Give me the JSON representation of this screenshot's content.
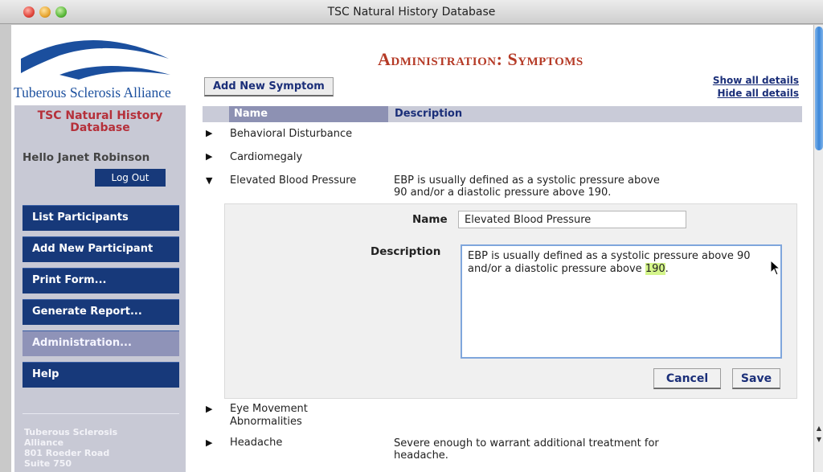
{
  "window": {
    "title": "TSC Natural History Database"
  },
  "sidebar": {
    "logo_text": "Tuberous Sclerosis Alliance",
    "db_title": "TSC Natural History Database",
    "greeting": "Hello Janet Robinson",
    "logout_label": "Log Out",
    "nav": [
      {
        "label": "List Participants"
      },
      {
        "label": "Add New Participant"
      },
      {
        "label": "Print Form..."
      },
      {
        "label": "Generate Report..."
      },
      {
        "label": "Administration..."
      },
      {
        "label": "Help"
      }
    ],
    "address": [
      "Tuberous Sclerosis",
      "Alliance",
      "801 Roeder Road",
      "Suite 750"
    ]
  },
  "main": {
    "title": "Administration: Symptoms",
    "add_button": "Add New Symptom",
    "show_all": "Show all details",
    "hide_all": "Hide all details",
    "columns": {
      "name": "Name",
      "description": "Description"
    },
    "rows": [
      {
        "name": "Behavioral Disturbance",
        "description": "",
        "expanded": false
      },
      {
        "name": "Cardiomegaly",
        "description": "",
        "expanded": false
      },
      {
        "name": "Elevated Blood Pressure",
        "description_lines": [
          "EBP is usually defined as a systolic pressure above",
          "90 and/or a diastolic pressure above 190."
        ],
        "expanded": true
      },
      {
        "name_lines": [
          "Eye Movement",
          "Abnormalities"
        ],
        "description": "",
        "expanded": false
      },
      {
        "name": "Headache",
        "description_lines": [
          "Severe enough to warrant additional treatment for",
          "headache."
        ],
        "expanded": false
      }
    ],
    "editor": {
      "name_label": "Name",
      "name_value": "Elevated Blood Pressure",
      "desc_label": "Description",
      "desc_line1": "EBP is usually defined as a systolic pressure above 90",
      "desc_line2_prefix": "and/or a diastolic pressure above ",
      "desc_highlight": "190",
      "desc_line2_suffix": ".",
      "cancel_label": "Cancel",
      "save_label": "Save"
    }
  },
  "colors": {
    "nav_blue": "#17397a",
    "nav_active": "#8f93b8",
    "title_red": "#b53a26",
    "db_title_red": "#b5303a",
    "link_blue": "#1b2f79",
    "highlight": "#d4f58a"
  }
}
